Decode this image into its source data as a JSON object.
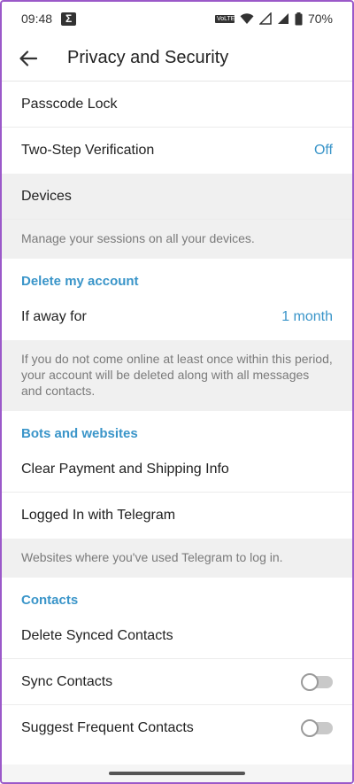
{
  "statusbar": {
    "time": "09:48",
    "sigma": "Σ",
    "volte": "VoLTE",
    "battery": "70%"
  },
  "appbar": {
    "title": "Privacy and Security"
  },
  "rows": {
    "passcode_lock": "Passcode Lock",
    "two_step": {
      "label": "Two-Step Verification",
      "value": "Off"
    },
    "devices": "Devices",
    "devices_info": "Manage your sessions on all your devices."
  },
  "delete_account": {
    "section": "Delete my account",
    "if_away": {
      "label": "If away for",
      "value": "1 month"
    },
    "info": "If you do not come online at least once within this period, your account will be deleted along with all messages and contacts."
  },
  "bots": {
    "section": "Bots and websites",
    "clear_payment": "Clear Payment and Shipping Info",
    "logged_in": "Logged In with Telegram",
    "info": "Websites where you've used Telegram to log in."
  },
  "contacts": {
    "section": "Contacts",
    "delete_synced": "Delete Synced Contacts",
    "sync": {
      "label": "Sync Contacts",
      "enabled": false
    },
    "suggest": {
      "label": "Suggest Frequent Contacts",
      "enabled": false
    }
  },
  "colors": {
    "accent": "#3a95c9",
    "info_bg": "#f0f0f0"
  },
  "icons": {
    "back": "arrow-left-icon",
    "wifi": "wifi-icon",
    "signal": "signal-icon",
    "battery": "battery-icon"
  }
}
